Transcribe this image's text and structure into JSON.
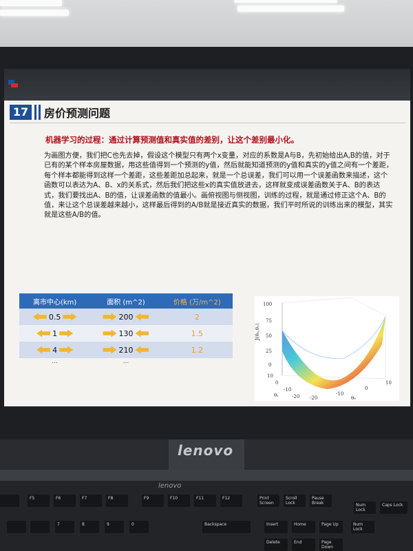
{
  "slide": {
    "number": "17",
    "title": "房价预测问题",
    "subtitle": "机器学习的过程：通过计算预测值和真实值的差别，让这个差别最小化。",
    "paragraph": "为画图方便，我们把C也先去掉，假设这个模型只有两个x变量，对应的系数是A与B，先初始给出A,B的值，对于已有的某个样本房屋数据，用这些值得到一个预测的y值，然后就能知道预测的y值和真实的y值之间有一个差距，每个样本都能得到这样一个差距，这些差距加总起来，就是一个总误差，我们可以用一个误差函数来描述，这个函数可以表达为A、B、x的关系式，然后我们把这些x的真实值放进去，这样就变成误差函数关于A、B的表达式，我们要找出A、B的值，让误差函数的值最小。画俯视图与侧视图，训练的过程，就是通过修正这个A、B的值，来让这个总误差越来越小，这样最后得到的A/B就是接近真实的数据，我们平时所说的训练出来的模型，其实就是这些A/B的值。"
  },
  "table": {
    "headers": [
      "离市中心(km)",
      "面积 (m^2)",
      "价格 (万/m^2)"
    ],
    "rows": [
      {
        "distance": "0.5",
        "area": "200",
        "price": "2"
      },
      {
        "distance": "1",
        "area": "130",
        "price": "1.5"
      },
      {
        "distance": "4",
        "area": "210",
        "price": "1.2"
      }
    ],
    "ellipsis": "..."
  },
  "plot": {
    "z_label": "J(θ₀,θ₁)",
    "z_ticks": [
      "100",
      "75",
      "50",
      "25",
      "0"
    ],
    "left_ticks": [
      "10",
      "0",
      "-10",
      "-20"
    ],
    "right_ticks": [
      "10",
      "0",
      "-10",
      "-20"
    ],
    "left_axis": "θ₁",
    "right_axis": "θ₀"
  },
  "monitor": {
    "brand": "lenovo"
  },
  "keyboard": {
    "brand": "lenovo",
    "keys": [
      "F5",
      "F6",
      "F7",
      "F8",
      "F9",
      "F10",
      "F11",
      "F12",
      "Print Screen",
      "Scroll Lock",
      "Pause Break",
      "Num Lock",
      "Caps Lock",
      "Backspace",
      "Insert",
      "Home",
      "Page Up",
      "Num Lock",
      "Delete",
      "End",
      "Page Down",
      "7",
      "8",
      "9",
      "0"
    ]
  },
  "colors": {
    "slide_blue": "#1f4f96",
    "table_header": "#2f6ab8",
    "subtitle_red": "#b0121d",
    "price_orange": "#f09a3a",
    "arrow_yellow": "#f3b62e"
  }
}
